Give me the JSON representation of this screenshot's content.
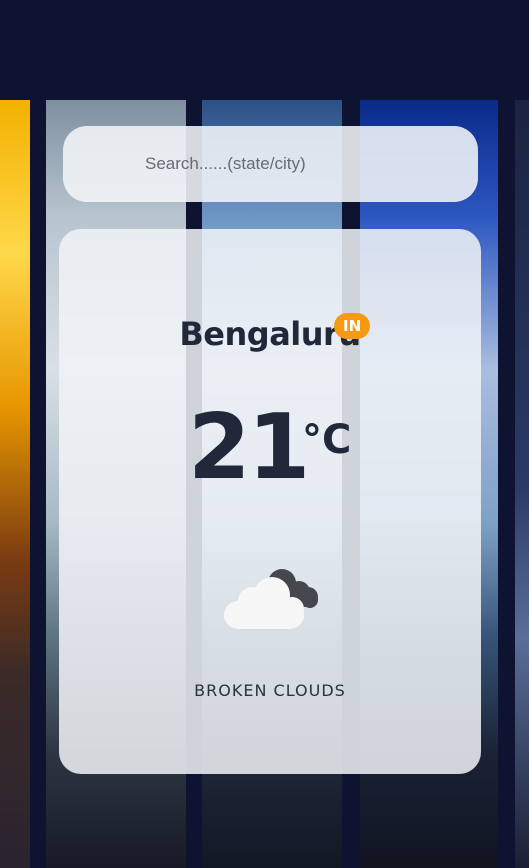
{
  "search": {
    "placeholder": "Search......(state/city)",
    "value": ""
  },
  "weather": {
    "city": "Bengaluru",
    "country": "IN",
    "temperature": "21",
    "unit": "°C",
    "condition": "BROKEN CLOUDS",
    "icon": "broken-clouds-icon"
  },
  "colors": {
    "badge": "#f59a12",
    "text": "#22283a",
    "background": "#0d1330"
  }
}
